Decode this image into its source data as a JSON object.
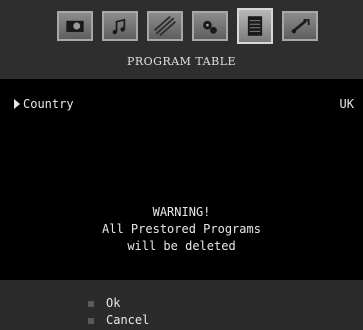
{
  "menu": {
    "title": "PROGRAM TABLE",
    "tabs": [
      {
        "icon": "picture-icon"
      },
      {
        "icon": "sound-icon"
      },
      {
        "icon": "feature-icon"
      },
      {
        "icon": "install-icon"
      },
      {
        "icon": "program-table-icon",
        "active": true
      },
      {
        "icon": "source-icon"
      }
    ]
  },
  "settings": {
    "country_label": "Country",
    "country_value": "UK"
  },
  "warning": {
    "line1": "WARNING!",
    "line2": "All Prestored Programs",
    "line3": "will be deleted"
  },
  "options": {
    "ok": "Ok",
    "cancel": "Cancel"
  },
  "colors": {
    "header_bg": "#2e2e2e",
    "body_bg": "#000000",
    "footer_bg": "#2b2b2b",
    "text": "#e8e8e8"
  }
}
